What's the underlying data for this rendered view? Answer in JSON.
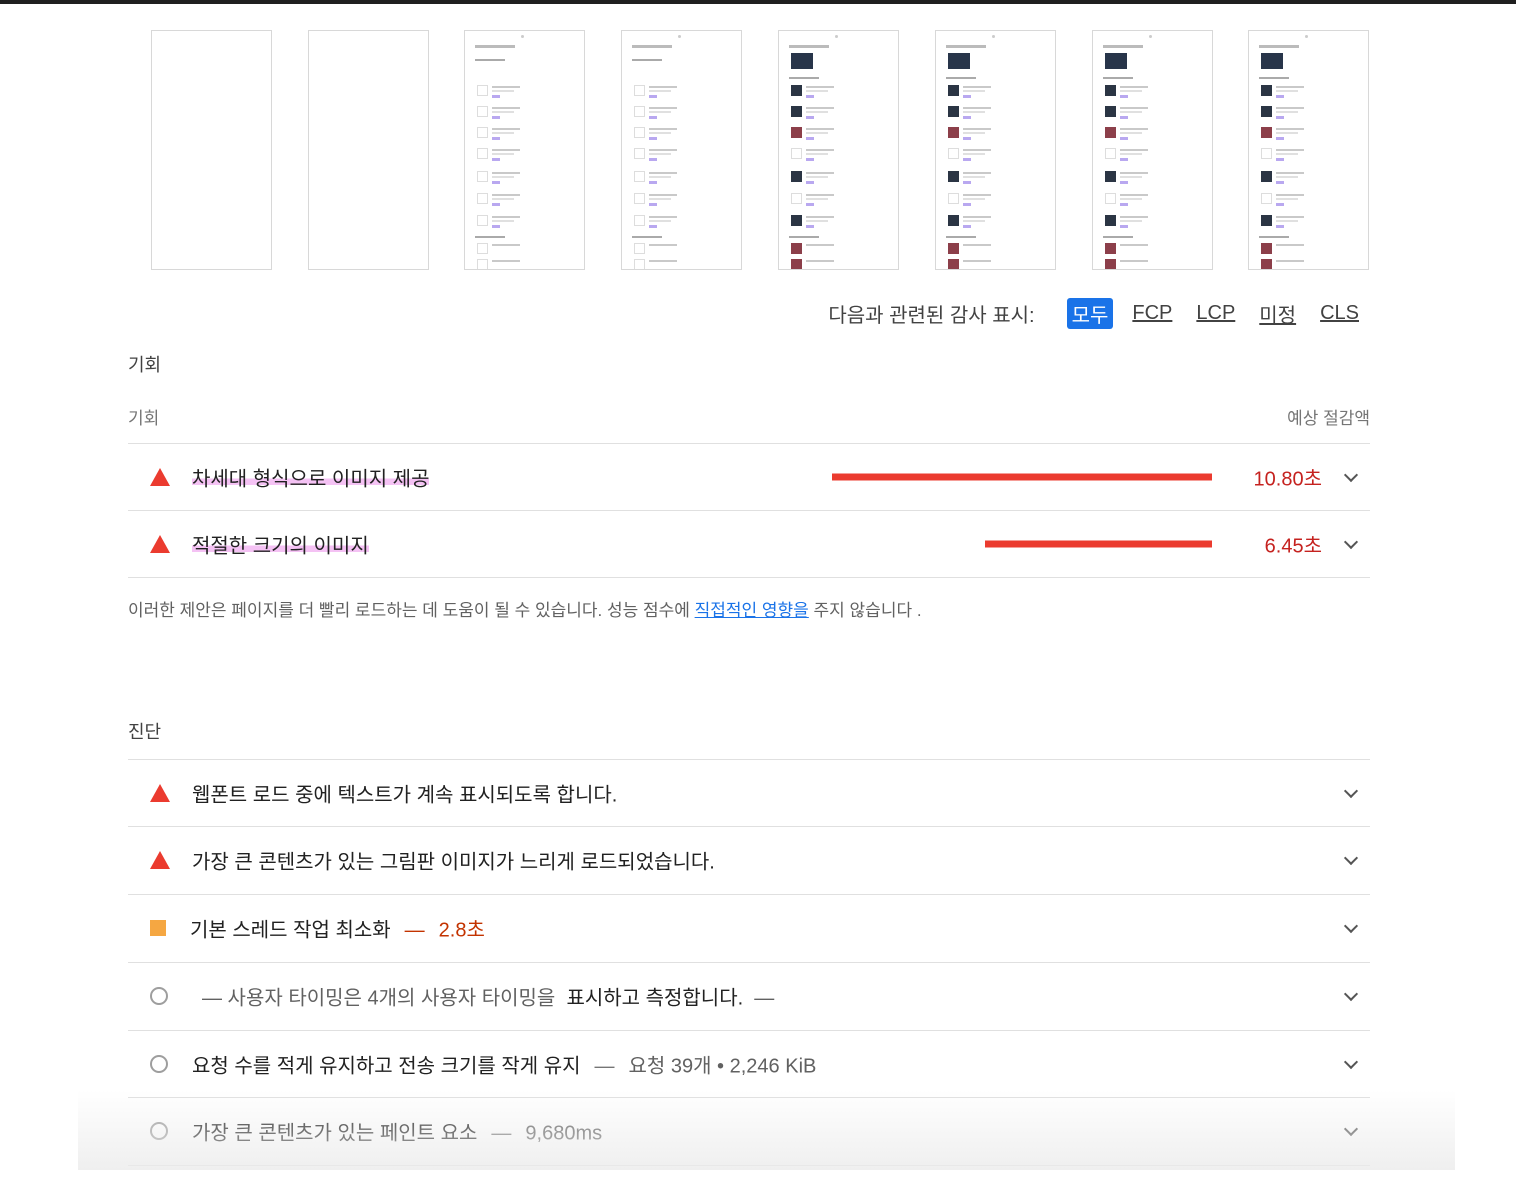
{
  "filter": {
    "label": "다음과 관련된 감사 표시:",
    "chips": [
      "모두",
      "FCP",
      "LCP",
      "미정",
      "CLS"
    ],
    "active": "모두"
  },
  "opportunities": {
    "section_title": "기회",
    "col_left": "기회",
    "col_right": "예상 절감액",
    "items": [
      {
        "title": "차세대 형식으로 이미지 제공",
        "saving": "10.80초",
        "severity": "fail",
        "saving_seconds": 10.8
      },
      {
        "title": "적절한 크기의 이미지",
        "saving": "6.45초",
        "severity": "fail",
        "saving_seconds": 6.45
      }
    ],
    "note_text": "이러한 제안은 페이지를 더 빨리 로드하는 데 도움이 될 수 있습니다. 성능 점수에 ",
    "note_link": "직접적인 영향을",
    "note_tail": " 주지 않습니다 ."
  },
  "diagnostics": {
    "section_title": "진단",
    "items": [
      {
        "title": "웹폰트 로드 중에 텍스트가 계속 표시되도록 합니다.",
        "severity": "fail"
      },
      {
        "title": "가장 큰 콘텐츠가 있는 그림판 이미지가 느리게 로드되었습니다.",
        "severity": "fail"
      },
      {
        "title": "기본 스레드 작업 최소화",
        "sep": "—",
        "meta": "2.8초",
        "severity": "average"
      },
      {
        "pre": "— 사용자 타이밍은 4개의 사용자 타이밍을",
        "title": "표시하고 측정합니다.",
        "post": "—",
        "severity": "info"
      },
      {
        "title": "요청 수를 적게 유지하고 전송 크기를 작게 유지",
        "sep": "—",
        "meta": "요청 39개 • 2,246 KiB",
        "severity": "info"
      },
      {
        "title": "가장 큰 콘텐츠가 있는 페인트 요소",
        "sep": "—",
        "meta": "9,680ms",
        "severity": "info"
      }
    ]
  },
  "icons": {
    "fail": "red-triangle-icon",
    "average": "orange-square-icon",
    "info": "gray-circle-icon",
    "expand": "chevron-down-icon"
  },
  "colors": {
    "fail": "#eb3b2f",
    "average": "#f5a742",
    "link": "#1a73e8",
    "active_chip": "#1a73e8"
  }
}
